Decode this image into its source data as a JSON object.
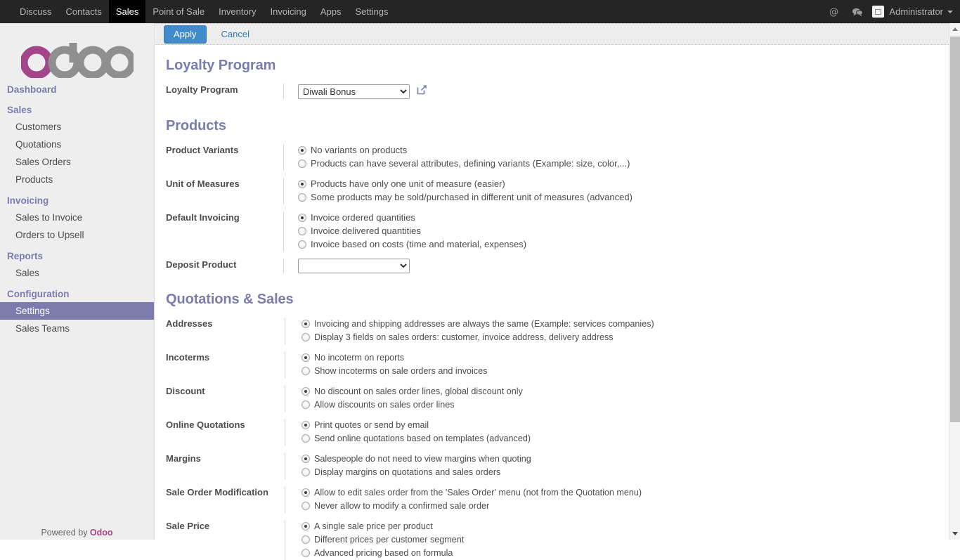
{
  "topbar": {
    "menu": [
      {
        "label": "Discuss",
        "active": false
      },
      {
        "label": "Contacts",
        "active": false
      },
      {
        "label": "Sales",
        "active": true
      },
      {
        "label": "Point of Sale",
        "active": false
      },
      {
        "label": "Inventory",
        "active": false
      },
      {
        "label": "Invoicing",
        "active": false
      },
      {
        "label": "Apps",
        "active": false
      },
      {
        "label": "Settings",
        "active": false
      }
    ],
    "mention_icon": "at-sign-icon",
    "messages_icon": "chat-bubble-icon",
    "user_name": "Administrator"
  },
  "sidebar": {
    "logo_text": "odoo",
    "groups": [
      {
        "title": "Dashboard",
        "items": []
      },
      {
        "title": "Sales",
        "items": [
          "Customers",
          "Quotations",
          "Sales Orders",
          "Products"
        ]
      },
      {
        "title": "Invoicing",
        "items": [
          "Sales to Invoice",
          "Orders to Upsell"
        ]
      },
      {
        "title": "Reports",
        "items": [
          "Sales"
        ]
      },
      {
        "title": "Configuration",
        "items": [
          "Settings",
          "Sales Teams"
        ]
      }
    ],
    "active_item": "Settings",
    "footer_prefix": "Powered by ",
    "footer_brand": "Odoo"
  },
  "toolbar": {
    "apply_label": "Apply",
    "cancel_label": "Cancel"
  },
  "sections": {
    "loyalty": {
      "title": "Loyalty Program",
      "rows": [
        {
          "label": "Loyalty Program",
          "type": "select",
          "value": "Diwali Bonus",
          "options": [
            "Diwali Bonus"
          ],
          "external_link_icon": "external-link-icon"
        }
      ]
    },
    "products": {
      "title": "Products",
      "rows": [
        {
          "label": "Product Variants",
          "type": "radio",
          "options": [
            {
              "text": "No variants on products",
              "selected": true
            },
            {
              "text": "Products can have several attributes, defining variants (Example: size, color,...)",
              "selected": false
            }
          ]
        },
        {
          "label": "Unit of Measures",
          "type": "radio",
          "options": [
            {
              "text": "Products have only one unit of measure (easier)",
              "selected": true
            },
            {
              "text": "Some products may be sold/purchased in different unit of measures (advanced)",
              "selected": false
            }
          ]
        },
        {
          "label": "Default Invoicing",
          "type": "radio",
          "options": [
            {
              "text": "Invoice ordered quantities",
              "selected": true
            },
            {
              "text": "Invoice delivered quantities",
              "selected": false
            },
            {
              "text": "Invoice based on costs (time and material, expenses)",
              "selected": false
            }
          ]
        },
        {
          "label": "Deposit Product",
          "type": "select",
          "value": "",
          "options": [
            ""
          ]
        }
      ]
    },
    "quotations": {
      "title": "Quotations & Sales",
      "rows": [
        {
          "label": "Addresses",
          "type": "radio",
          "options": [
            {
              "text": "Invoicing and shipping addresses are always the same (Example: services companies)",
              "selected": true
            },
            {
              "text": "Display 3 fields on sales orders: customer, invoice address, delivery address",
              "selected": false
            }
          ]
        },
        {
          "label": "Incoterms",
          "type": "radio",
          "options": [
            {
              "text": "No incoterm on reports",
              "selected": true
            },
            {
              "text": "Show incoterms on sale orders and invoices",
              "selected": false
            }
          ]
        },
        {
          "label": "Discount",
          "type": "radio",
          "options": [
            {
              "text": "No discount on sales order lines, global discount only",
              "selected": true
            },
            {
              "text": "Allow discounts on sales order lines",
              "selected": false
            }
          ]
        },
        {
          "label": "Online Quotations",
          "type": "radio",
          "options": [
            {
              "text": "Print quotes or send by email",
              "selected": true
            },
            {
              "text": "Send online quotations based on templates (advanced)",
              "selected": false
            }
          ]
        },
        {
          "label": "Margins",
          "type": "radio",
          "options": [
            {
              "text": "Salespeople do not need to view margins when quoting",
              "selected": true
            },
            {
              "text": "Display margins on quotations and sales orders",
              "selected": false
            }
          ]
        },
        {
          "label": "Sale Order Modification",
          "type": "radio",
          "options": [
            {
              "text": "Allow to edit sales order from the 'Sales Order' menu (not from the Quotation menu)",
              "selected": true
            },
            {
              "text": "Never allow to modify a confirmed sale order",
              "selected": false
            }
          ]
        },
        {
          "label": "Sale Price",
          "type": "radio",
          "options": [
            {
              "text": "A single sale price per product",
              "selected": true
            },
            {
              "text": "Different prices per customer segment",
              "selected": false
            },
            {
              "text": "Advanced pricing based on formula",
              "selected": false
            }
          ]
        }
      ]
    }
  },
  "scrollbar": {
    "up_icon": "scroll-up-arrow-icon",
    "down_icon": "scroll-down-arrow-icon"
  },
  "colors": {
    "brand_purple": "#7c7bad",
    "brand_magenta": "#a24689",
    "accent_blue": "#428bca",
    "navbar_bg": "#252525"
  }
}
